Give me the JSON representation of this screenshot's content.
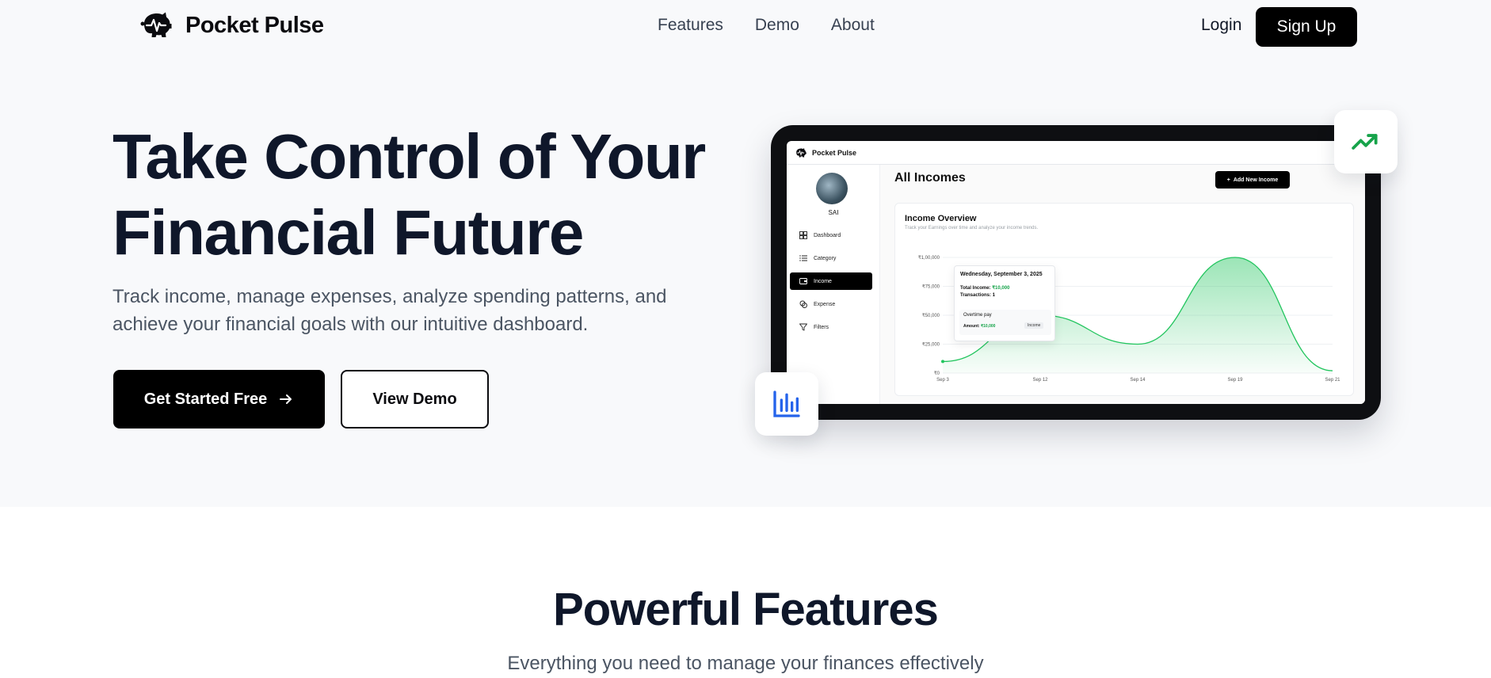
{
  "brand": {
    "name": "Pocket Pulse"
  },
  "nav": {
    "links": [
      "Features",
      "Demo",
      "About"
    ],
    "login_label": "Login",
    "signup_label": "Sign Up"
  },
  "hero": {
    "title_line1": "Take Control of Your",
    "title_line2": "Financial Future",
    "subtitle": "Track income, manage expenses, analyze spending patterns, and achieve your financial goals with our intuitive dashboard.",
    "primary_label": "Get Started Free",
    "secondary_label": "View Demo"
  },
  "preview": {
    "app_name": "Pocket Pulse",
    "user_name": "SAI",
    "sidebar": [
      {
        "label": "Dashboard",
        "icon": "dashboard-icon",
        "active": false
      },
      {
        "label": "Category",
        "icon": "list-icon",
        "active": false
      },
      {
        "label": "Income",
        "icon": "wallet-icon",
        "active": true
      },
      {
        "label": "Expense",
        "icon": "coins-icon",
        "active": false
      },
      {
        "label": "Filters",
        "icon": "filter-icon",
        "active": false
      }
    ],
    "page_title": "All Incomes",
    "add_button_label": "Add New Income",
    "card_title": "Income Overview",
    "card_subtitle": "Track your Earnings over time and analyze your income trends.",
    "tooltip": {
      "date": "Wednesday, September 3, 2025",
      "total_label": "Total Income:",
      "total_value": "₹10,000",
      "transactions_label": "Transactions: 1",
      "item_name": "Overtime pay",
      "item_amount_label": "Amount:",
      "item_amount_value": "₹10,000",
      "item_badge": "Income"
    }
  },
  "chart_data": {
    "type": "area",
    "title": "Income Overview",
    "x": [
      "Sep 3",
      "Sep 12",
      "Sep 14",
      "Sep 19",
      "Sep 21"
    ],
    "y_ticks": [
      "₹0",
      "₹25,000",
      "₹50,000",
      "₹75,000",
      "₹1,00,000"
    ],
    "ylim": [
      0,
      100000
    ],
    "series": [
      {
        "values": [
          10000,
          50000,
          25000,
          100000,
          2000
        ]
      }
    ],
    "color": "#22c55e",
    "grid": true
  },
  "features": {
    "title": "Powerful Features",
    "subtitle": "Everything you need to manage your finances effectively"
  },
  "floating": {
    "top_icon": "trend-up-icon",
    "bottom_icon": "bar-chart-icon"
  },
  "colors": {
    "accent_green": "#16a34a",
    "primary": "#000000",
    "text_dark": "#0f172a",
    "text_muted": "#4b5563"
  }
}
